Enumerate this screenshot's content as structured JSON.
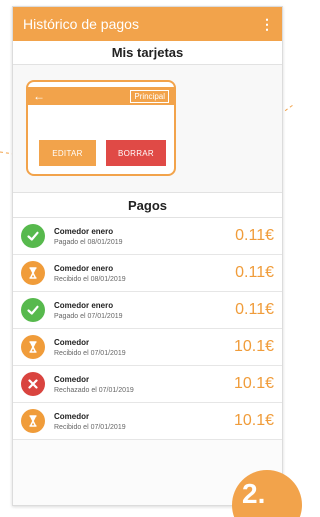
{
  "appbar": {
    "title": "Histórico de pagos",
    "menu_icon": "kebab-menu-icon",
    "color": "#f2a34b"
  },
  "cards": {
    "title": "Mis tarjetas",
    "card": {
      "back_icon": "arrow-left-icon",
      "badge": "Principal"
    },
    "actions": {
      "edit": "EDITAR",
      "delete": "BORRAR"
    }
  },
  "payments": {
    "title": "Pagos",
    "items": [
      {
        "status": "paid",
        "icon": "check-icon",
        "name": "Comedor enero",
        "date": "Pagado el 08/01/2019",
        "amount": "0.11€"
      },
      {
        "status": "pending",
        "icon": "hourglass-icon",
        "name": "Comedor enero",
        "date": "Recibido el 08/01/2019",
        "amount": "0.11€"
      },
      {
        "status": "paid",
        "icon": "check-icon",
        "name": "Comedor enero",
        "date": "Pagado el 07/01/2019",
        "amount": "0.11€"
      },
      {
        "status": "pending",
        "icon": "hourglass-icon",
        "name": "Comedor",
        "date": "Recibido el 07/01/2019",
        "amount": "10.1€"
      },
      {
        "status": "rejected",
        "icon": "x-icon",
        "name": "Comedor",
        "date": "Rechazado el 07/01/2019",
        "amount": "10.1€"
      },
      {
        "status": "pending",
        "icon": "hourglass-icon",
        "name": "Comedor",
        "date": "Recibido el 07/01/2019",
        "amount": "10.1€"
      }
    ]
  },
  "step_badge": "2.",
  "colors": {
    "accent": "#f2a34b",
    "paid": "#57b94d",
    "pending": "#f09c3a",
    "rejected": "#d9443f",
    "delete": "#e04a46"
  }
}
